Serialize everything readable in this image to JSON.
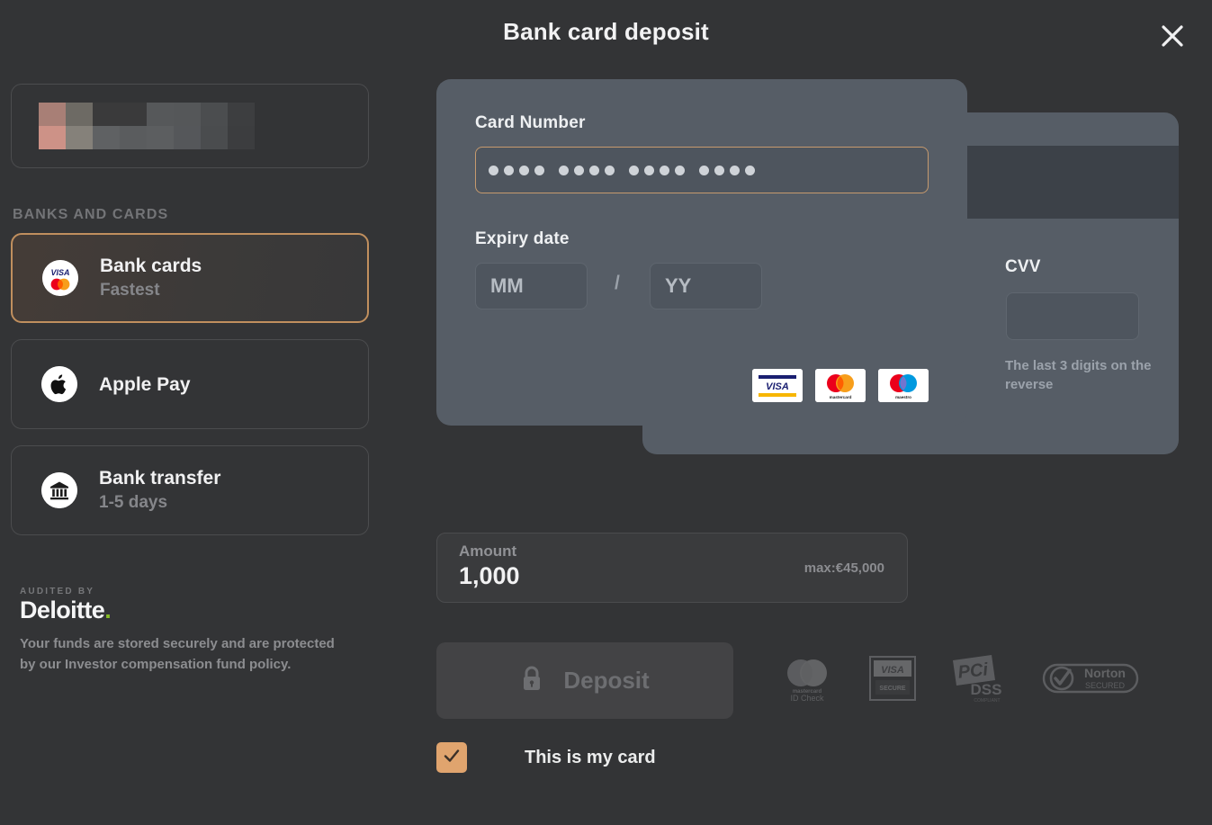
{
  "header": {
    "title": "Bank card deposit",
    "close_icon": "close-icon"
  },
  "sidebar": {
    "balance_redacted": true,
    "section_label": "BANKS AND CARDS",
    "methods": [
      {
        "title": "Bank cards",
        "subtitle": "Fastest",
        "icon": "visa-mastercard-icon",
        "selected": true
      },
      {
        "title": "Apple Pay",
        "subtitle": "",
        "icon": "apple-icon",
        "selected": false
      },
      {
        "title": "Bank transfer",
        "subtitle": "1-5 days",
        "icon": "bank-building-icon",
        "selected": false
      }
    ],
    "audit": {
      "kicker": "AUDITED BY",
      "logo": "Deloitte",
      "logo_dot": ".",
      "text": "Your funds are stored securely and are protected by our Investor compensation fund policy."
    }
  },
  "card_form": {
    "card_number_label": "Card Number",
    "card_number_value": "•••• •••• •••• ••••",
    "card_number_masked_digits": 16,
    "expiry_label": "Expiry date",
    "expiry_month_placeholder": "MM",
    "expiry_year_placeholder": "YY",
    "expiry_separator": "/",
    "accepted_brands": [
      "visa",
      "mastercard",
      "maestro"
    ]
  },
  "cvv": {
    "label": "CVV",
    "value": "",
    "hint": "The last 3 digits on the reverse"
  },
  "amount": {
    "label": "Amount",
    "value": "1,000",
    "max_label": "max:€45,000"
  },
  "actions": {
    "deposit_label": "Deposit",
    "deposit_icon": "lock-icon",
    "deposit_disabled": true,
    "checkbox_label": "This is my card",
    "checkbox_checked": true
  },
  "trust_badges": [
    {
      "name": "mastercard-id-check-badge",
      "line1": "mastercard",
      "line2": "ID Check"
    },
    {
      "name": "visa-secure-badge",
      "line1": "VISA",
      "line2": "SECURE"
    },
    {
      "name": "pci-dss-badge",
      "line1": "PCI",
      "line2": "DSS",
      "line3": "COMPLIANT"
    },
    {
      "name": "norton-secured-badge",
      "line1": "Norton",
      "line2": "SECURED"
    }
  ],
  "colors": {
    "background": "#333436",
    "panel": "#565d66",
    "accent": "#c08f5e",
    "checkbox": "#e0a46e",
    "deloitte_green": "#86bc25"
  }
}
